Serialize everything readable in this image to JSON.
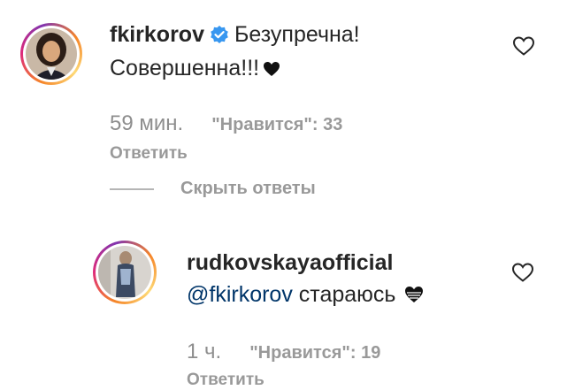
{
  "comments": [
    {
      "username": "fkirkorov",
      "verified": true,
      "text_line1": "Безупречна!",
      "text_line2": "Совершенна!!!",
      "text_emoji_icon": "black-heart-icon",
      "time": "59 мин.",
      "likes_label": "\"Нравится\": 33",
      "reply_label": "Ответить",
      "like_icon": "heart-outline-icon"
    },
    {
      "username": "rudkovskayaofficial",
      "verified": false,
      "mention": "@fkirkorov",
      "text": "стараюсь",
      "text_emoji_icon": "black-heart-icon",
      "time": "1 ч.",
      "likes_label": "\"Нравится\": 19",
      "reply_label": "Ответить",
      "like_icon": "heart-outline-icon"
    }
  ],
  "hide_replies_label": "Скрыть ответы",
  "colors": {
    "text": "#262626",
    "muted": "#999999",
    "mention": "#003569",
    "verified": "#3897f0"
  }
}
